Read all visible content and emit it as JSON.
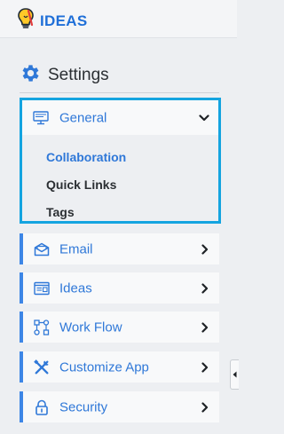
{
  "brand": {
    "name": "IDEAS",
    "icon": "lightbulb-icon"
  },
  "settings": {
    "title": "Settings",
    "icon": "gear-icon"
  },
  "colors": {
    "accent": "#2f78d8",
    "highlight_border": "#14a4e0",
    "row_marker": "#3d86e6",
    "text": "#2b2f33"
  },
  "menu": {
    "general": {
      "label": "General",
      "icon": "monitor-icon",
      "expanded": true,
      "children": [
        {
          "label": "Collaboration",
          "active": true
        },
        {
          "label": "Quick Links",
          "active": false
        },
        {
          "label": "Tags",
          "active": false
        }
      ]
    },
    "items": [
      {
        "label": "Email",
        "icon": "envelope-icon"
      },
      {
        "label": "Ideas",
        "icon": "browser-window-icon"
      },
      {
        "label": "Work Flow",
        "icon": "workflow-icon"
      },
      {
        "label": "Customize App",
        "icon": "tools-icon"
      },
      {
        "label": "Security",
        "icon": "lock-icon"
      }
    ]
  }
}
